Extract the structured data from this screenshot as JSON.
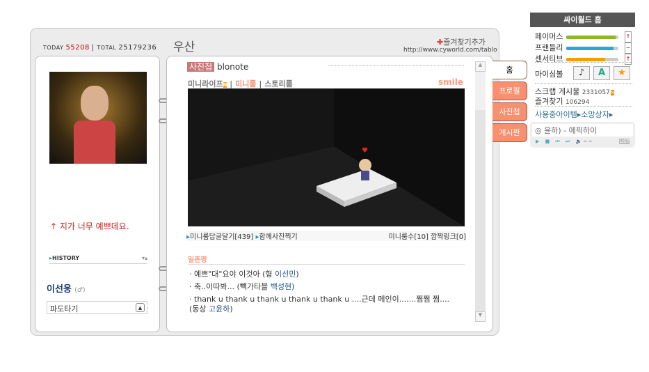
{
  "counter": {
    "today_label": "TODAY",
    "today": "55208",
    "total_label": "TOTAL",
    "total": "25179236"
  },
  "title": "우산",
  "favorite_add": "즐겨찾기추가",
  "url": "http://www.cyworld.com/tablo",
  "profile": {
    "caption": "↑ 지가 너무 예쁘데요.",
    "history": "HISTORY",
    "name": "이선웅",
    "gender": "(♂)",
    "select": "파도타기"
  },
  "main": {
    "category": "사진첩",
    "subtitle": "blonote",
    "nav": [
      "미니라이프",
      "미니룸",
      "스토리룸"
    ],
    "mood": "smile",
    "links": [
      "미니룸답글달기[439]",
      "함께사진찍기"
    ],
    "stats": "미니룸수[10]  깜짝링크[0]",
    "comments_title": "일촌평",
    "comments": [
      {
        "text": "예쁘\"대\"요야 이것아 (형 ",
        "name": "이선민",
        "end": ")"
      },
      {
        "text": "축..이따봐... (빽가타블 ",
        "name": "백성현",
        "end": ")"
      },
      {
        "text": "thank u thank u thank u thank u thank u ....근데 메인이.......쩜쩜 쩜.... (동상 ",
        "name": "고윤하",
        "end": ")"
      }
    ]
  },
  "tabs": [
    "홈",
    "프로필",
    "사진첩",
    "게시판"
  ],
  "sidebar": {
    "home": "싸이월드 홈",
    "stats": [
      {
        "label": "페이머스",
        "value": 0.95,
        "color": "#8ab82a",
        "sign": "+"
      },
      {
        "label": "프랜들리",
        "value": 0.9,
        "color": "#2aa8d0",
        "sign": "-"
      },
      {
        "label": "센서티브",
        "value": 0.75,
        "color": "#f0a000",
        "sign": "+"
      }
    ],
    "symbol_label": "마이심볼",
    "scrap_label": "스크랩 게시물",
    "scrap": "2331057",
    "fav_label": "즐겨찾기",
    "fav": "106294",
    "items": "사용중아이템",
    "wish": "소망상자",
    "song": "윤하) - 에픽하이",
    "list": "LIST"
  }
}
